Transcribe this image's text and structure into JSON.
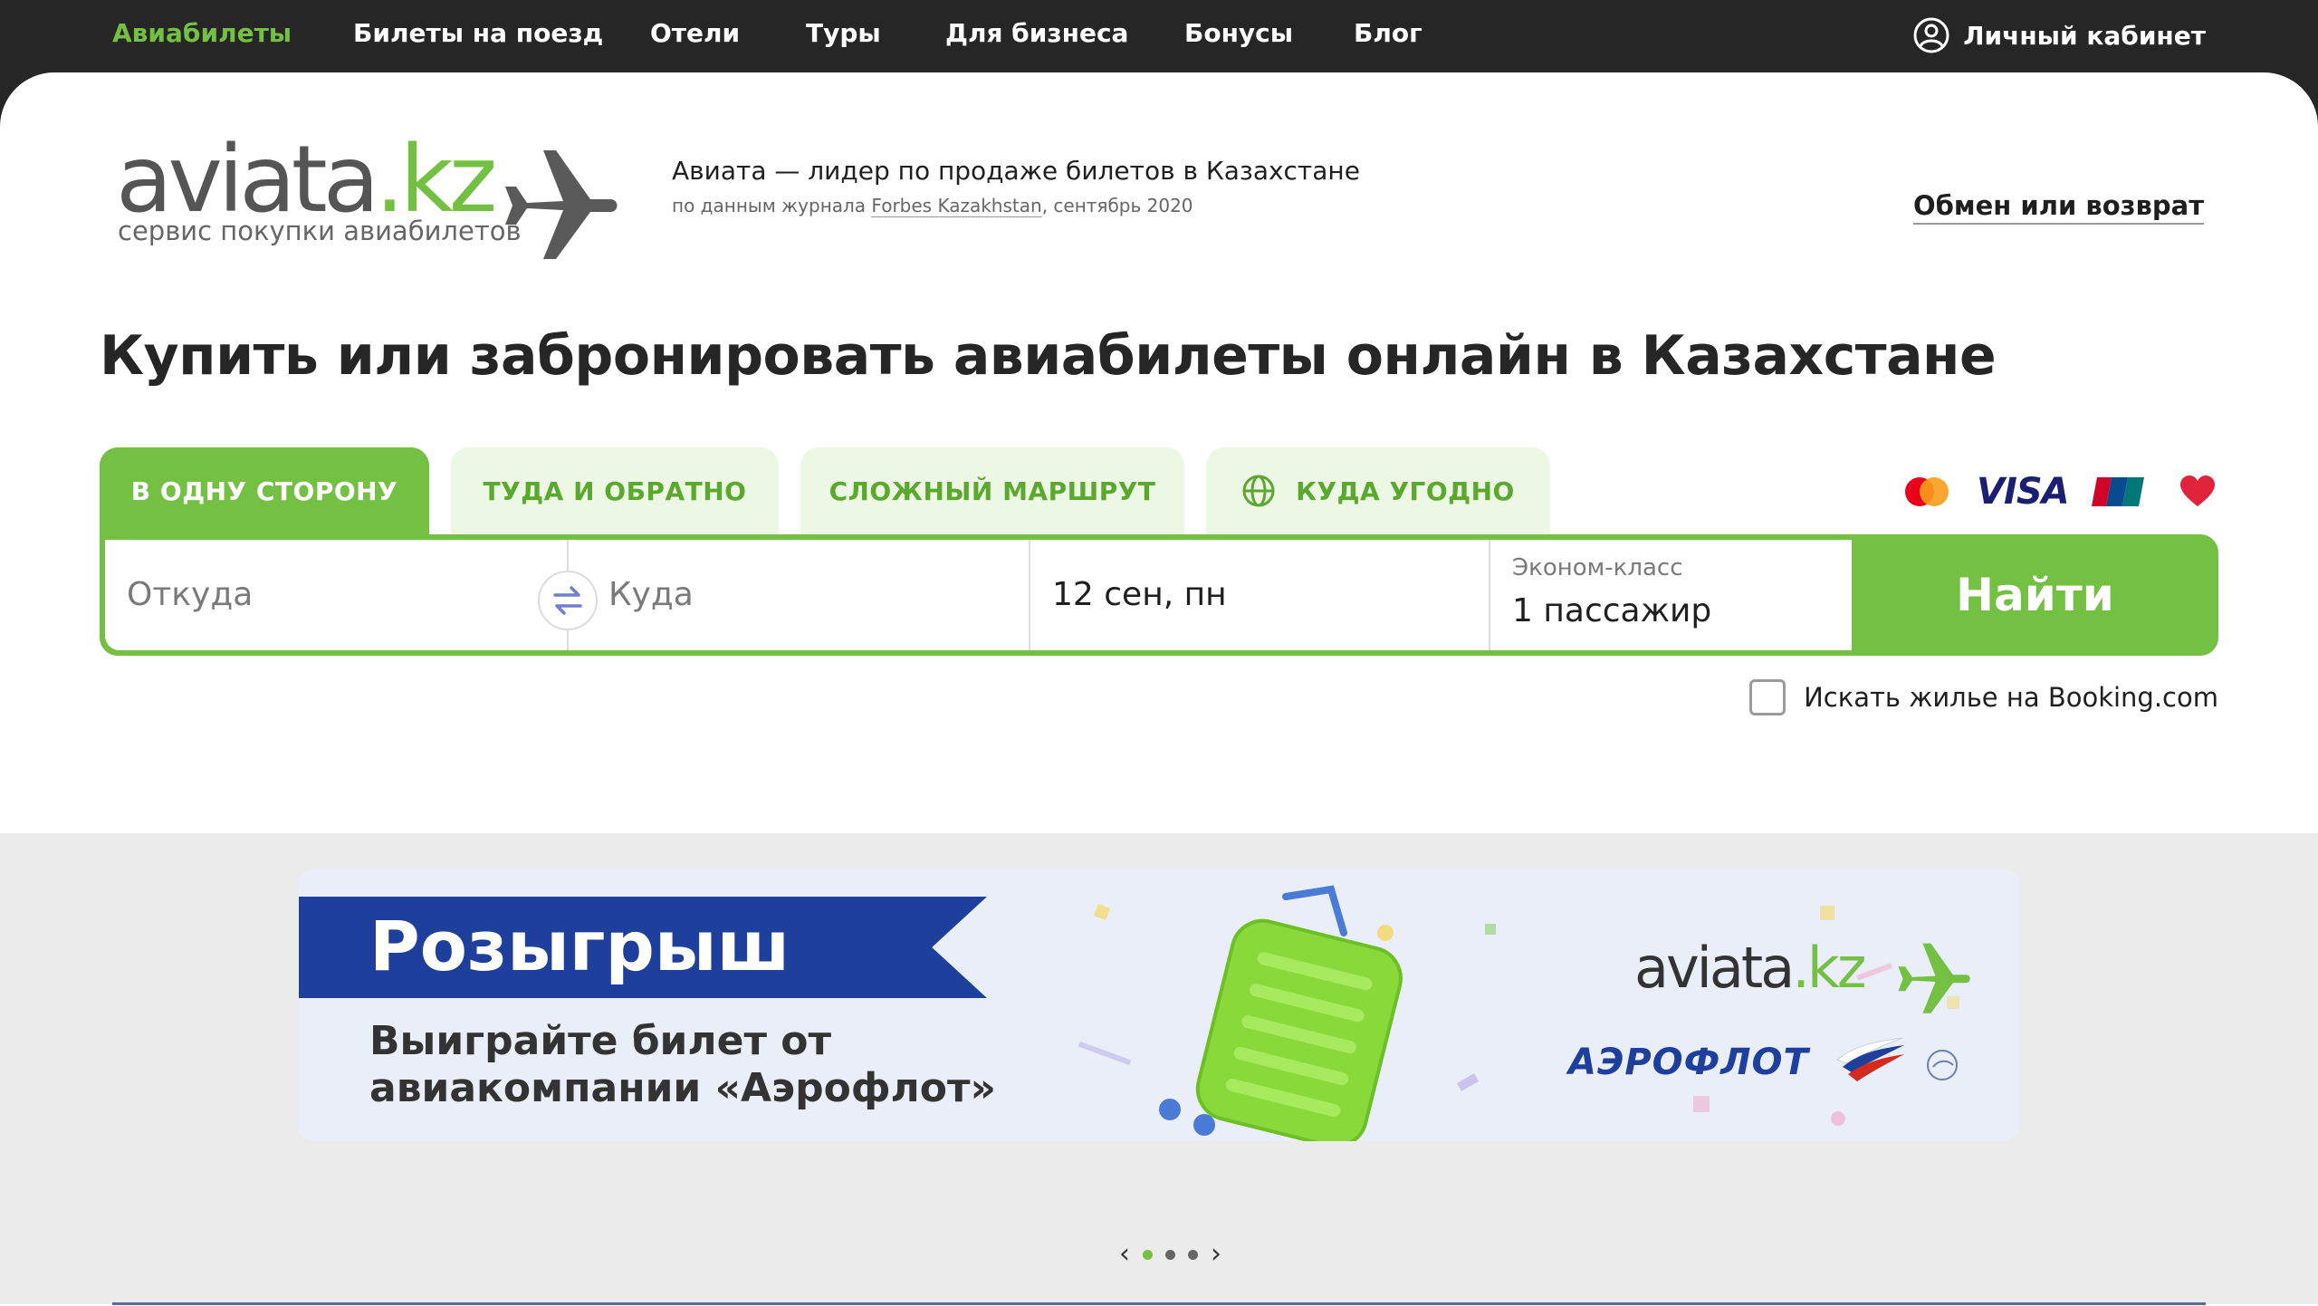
{
  "topnav": {
    "items": [
      {
        "label": "Авиабилеты",
        "active": true
      },
      {
        "label": "Билеты на поезд",
        "active": false
      },
      {
        "label": "Отели",
        "active": false
      },
      {
        "label": "Туры",
        "active": false
      },
      {
        "label": "Для бизнеса",
        "active": false
      },
      {
        "label": "Бонусы",
        "active": false
      },
      {
        "label": "Блог",
        "active": false
      }
    ],
    "cabinet_label": "Личный кабинет",
    "cabinet_icon": "user-circle-icon"
  },
  "header": {
    "logo_main": "aviata",
    "logo_dot_kz": ".kz",
    "logo_tagline": "сервис покупки авиабилетов",
    "lead_title": "Авиата — лидер по продаже билетов в Казахстане",
    "lead_prefix": "по данным журнала ",
    "lead_source": "Forbes Kazakhstan",
    "lead_suffix": ", сентябрь 2020",
    "exchange_link": "Обмен или возврат"
  },
  "page_title": "Купить или забронировать авиабилеты онлайн в Казахстане",
  "search": {
    "tabs": [
      {
        "label": "В ОДНУ СТОРОНУ",
        "active": true
      },
      {
        "label": "ТУДА И ОБРАТНО",
        "active": false
      },
      {
        "label": "СЛОЖНЫЙ МАРШРУТ",
        "active": false
      },
      {
        "label": "КУДА УГОДНО",
        "active": false,
        "icon": "globe-icon"
      }
    ],
    "payment_icons": [
      "mastercard-icon",
      "visa-icon",
      "unionpay-icon",
      "heart-icon"
    ],
    "visa_text": "VISA",
    "from_placeholder": "Откуда",
    "to_placeholder": "Куда",
    "date_value": "12 сен, пн",
    "class_label": "Эконом-класс",
    "passengers_value": "1 пассажир",
    "find_button": "Найти",
    "booking_checkbox_label": "Искать жилье на Booking.com",
    "booking_checked": false
  },
  "promo": {
    "ribbon_title": "Розыгрыш",
    "subtitle_line1": "Выиграйте билет от",
    "subtitle_line2": "авиакомпании «Аэрофлот»",
    "logo_main": "aviata",
    "logo_dot_kz": ".kz",
    "partner": "АЭРОФЛОТ",
    "slide_count": 3,
    "active_slide": 1
  },
  "colors": {
    "brand_green": "#74c043",
    "light_green": "#ecf8e3",
    "dark_nav": "#262626",
    "aeroflot_blue": "#1e3f9b"
  }
}
